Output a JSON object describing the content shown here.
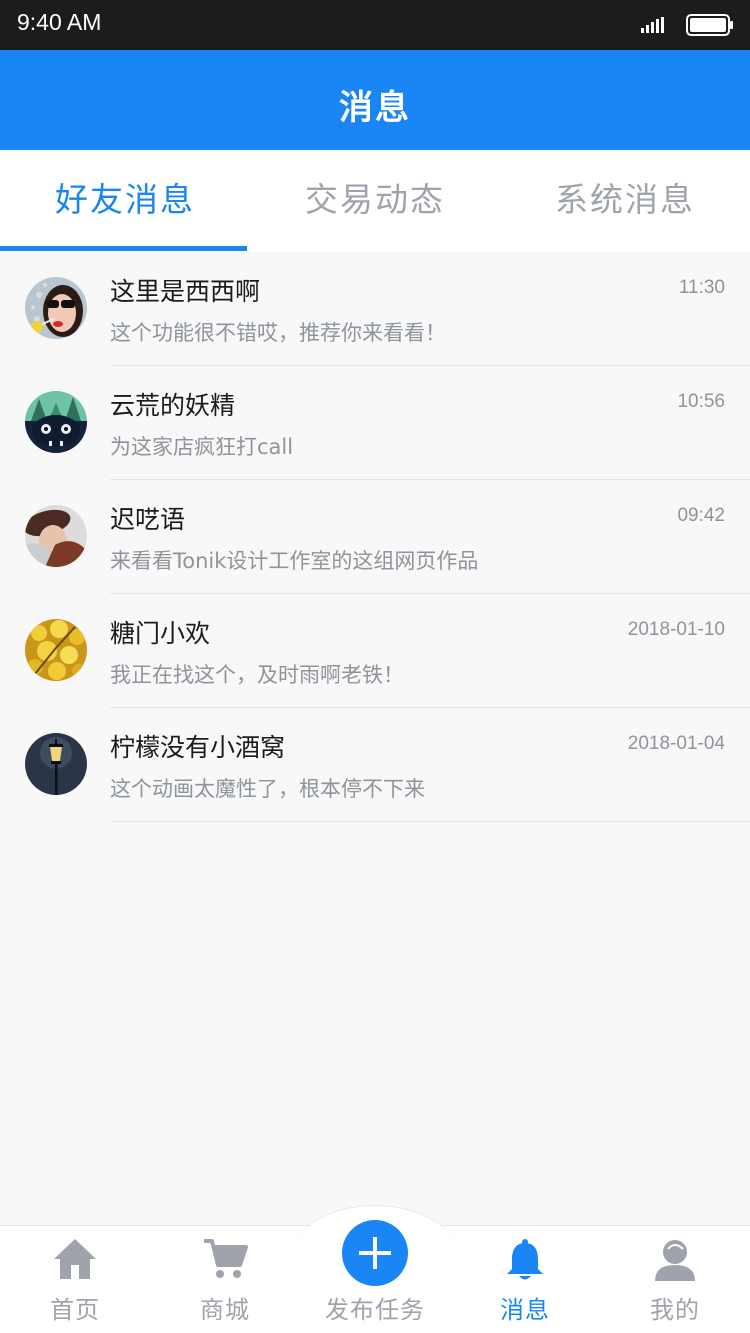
{
  "status_bar": {
    "time": "9:40 AM"
  },
  "header": {
    "title": "消息"
  },
  "tabs": [
    {
      "label": "好友消息",
      "active": true
    },
    {
      "label": "交易动态",
      "active": false
    },
    {
      "label": "系统消息",
      "active": false
    }
  ],
  "messages": [
    {
      "name": "这里是西西啊",
      "preview": "这个功能很不错哎，推荐你来看看！",
      "time": "11:30",
      "avatar": "woman-sunglasses-avatar"
    },
    {
      "name": "云荒的妖精",
      "preview": "为这家店疯狂打call",
      "time": "10:56",
      "avatar": "forest-creature-avatar"
    },
    {
      "name": "迟呓语",
      "preview": "来看看Tonik设计工作室的这组网页作品",
      "time": "09:42",
      "avatar": "man-with-hat-avatar"
    },
    {
      "name": "糖门小欢",
      "preview": "我正在找这个，及时雨啊老铁！",
      "time": "2018-01-10",
      "avatar": "yellow-flowers-avatar"
    },
    {
      "name": "柠檬没有小酒窝",
      "preview": "这个动画太魔性了，根本停不下来",
      "time": "2018-01-04",
      "avatar": "street-lamp-avatar"
    }
  ],
  "tabbar": {
    "items": [
      {
        "label": "首页",
        "icon": "home-icon",
        "active": false
      },
      {
        "label": "商城",
        "icon": "cart-icon",
        "active": false
      },
      {
        "label": "发布任务",
        "icon": "plus-icon",
        "active": false
      },
      {
        "label": "消息",
        "icon": "bell-icon",
        "active": true
      },
      {
        "label": "我的",
        "icon": "user-icon",
        "active": false
      }
    ]
  },
  "colors": {
    "accent": "#1a86f5",
    "inactive": "#9fa3ab",
    "status_bar": "#1c1c1c"
  }
}
